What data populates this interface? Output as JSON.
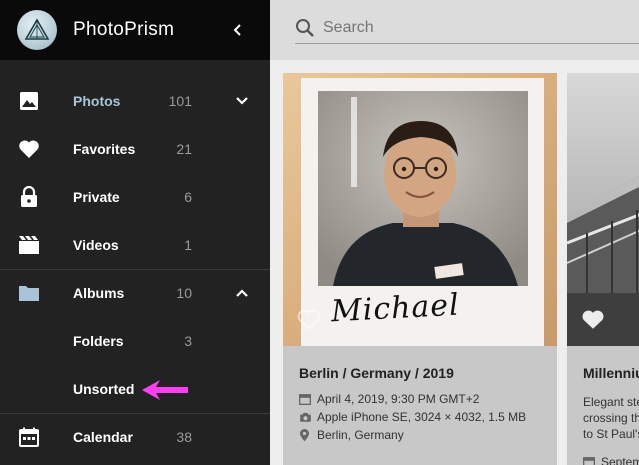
{
  "app": {
    "title": "PhotoPrism"
  },
  "search": {
    "placeholder": "Search"
  },
  "sidebar": {
    "items": [
      {
        "label": "Photos",
        "count": "101",
        "icon": "image-icon"
      },
      {
        "label": "Favorites",
        "count": "21",
        "icon": "heart-icon"
      },
      {
        "label": "Private",
        "count": "6",
        "icon": "lock-icon"
      },
      {
        "label": "Videos",
        "count": "1",
        "icon": "video-icon"
      },
      {
        "label": "Albums",
        "count": "10",
        "icon": "folder-icon"
      },
      {
        "label": "Calendar",
        "count": "38",
        "icon": "calendar-icon"
      }
    ],
    "subitems": [
      {
        "label": "Folders",
        "count": "3"
      },
      {
        "label": "Unsorted"
      }
    ]
  },
  "cards": [
    {
      "title": "Berlin / Germany / 2019",
      "date": "April 4, 2019, 9:30 PM GMT+2",
      "camera": "Apple iPhone SE, 3024 × 4032, 1.5 MB",
      "location": "Berlin, Germany",
      "signature": "Michael"
    },
    {
      "title": "Millenniu",
      "desc_line1": "Elegant ste",
      "desc_line2": "crossing th",
      "desc_line3": "to St Paul's",
      "date": "Septem"
    }
  ],
  "colors": {
    "sidebar_bg": "#222222",
    "header_bg": "#0a0a0a",
    "active_label": "#a9c4d6",
    "annotation_arrow": "#ff3ef2"
  }
}
